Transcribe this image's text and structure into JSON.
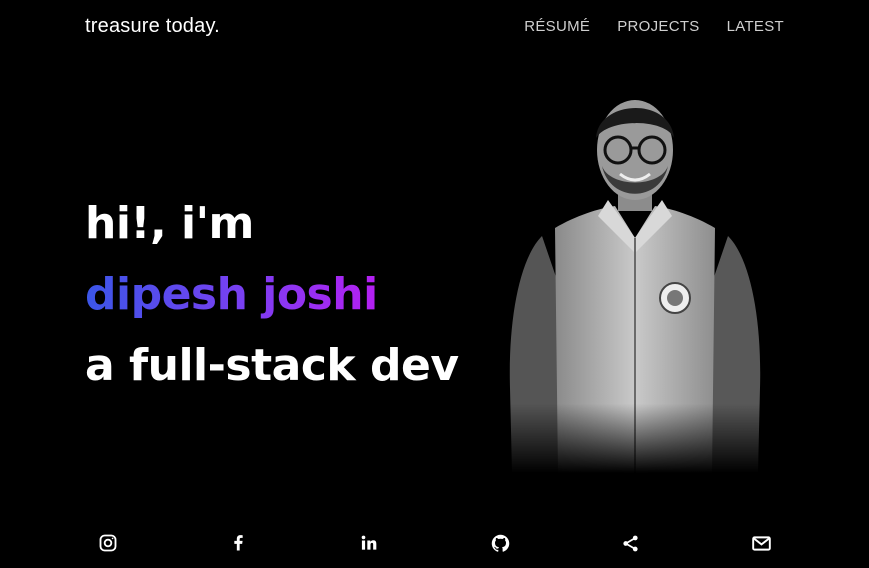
{
  "header": {
    "brand": "treasure today.",
    "nav": [
      "RÉSUMÉ",
      "PROJECTS",
      "LATEST"
    ]
  },
  "hero": {
    "line1": "hi!, i'm",
    "name": "dipesh joshi",
    "line3": "a full-stack dev"
  },
  "colors": {
    "background": "#000000",
    "gradient_start": "#3b56e8",
    "gradient_end": "#b51ff2",
    "nav_text": "#cfcfcf"
  },
  "social_icons": [
    "instagram-icon",
    "facebook-icon",
    "linkedin-icon",
    "github-icon",
    "share-icon",
    "mail-icon"
  ]
}
